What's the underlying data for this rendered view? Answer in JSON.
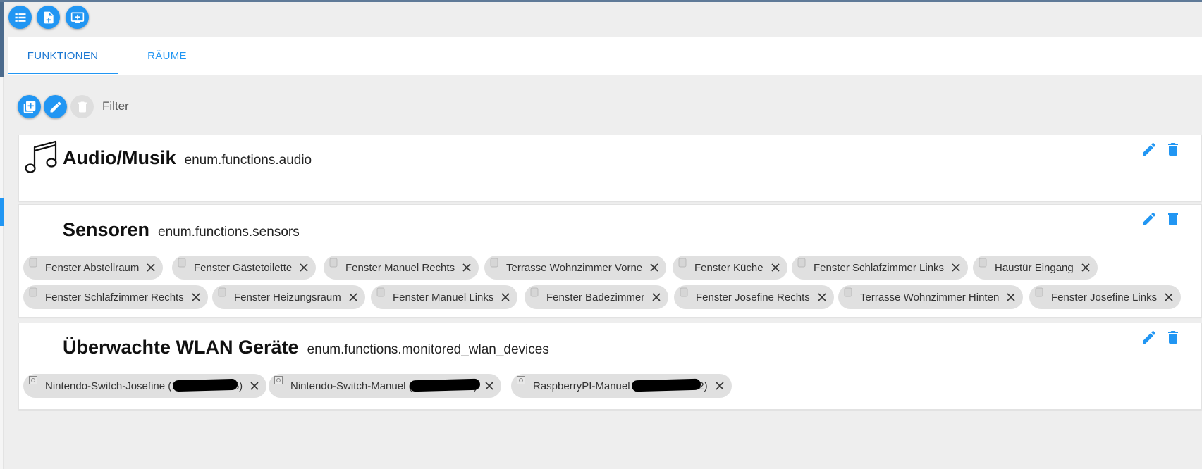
{
  "toolbar_top": {
    "buttons": [
      {
        "name": "list-view-button",
        "icon": "list-icon"
      },
      {
        "name": "add-file-button",
        "icon": "file-plus-icon"
      },
      {
        "name": "add-window-button",
        "icon": "window-plus-icon"
      }
    ]
  },
  "tabs": [
    {
      "label": "FUNKTIONEN",
      "active": true
    },
    {
      "label": "RÄUME",
      "active": false
    }
  ],
  "list_toolbar": {
    "add_icon": "add-library-icon",
    "edit_icon": "pencil-icon",
    "delete_icon": "trash-icon",
    "filter_placeholder": "Filter",
    "filter_value": ""
  },
  "enums": [
    {
      "name": "Audio/Musik",
      "id": "enum.functions.audio",
      "icon": "music-note-icon",
      "members": []
    },
    {
      "name": "Sensoren",
      "id": "enum.functions.sensors",
      "members": [
        "Fenster Abstellraum",
        "Fenster Gästetoilette",
        "Fenster Manuel Rechts",
        "Terrasse Wohnzimmer Vorne",
        "Fenster Küche",
        "Fenster Schlafzimmer Links",
        "Haustür Eingang",
        "Fenster Schlafzimmer Rechts",
        "Fenster Heizungsraum",
        "Fenster Manuel Links",
        "Fenster Badezimmer",
        "Fenster Josefine Rechts",
        "Terrasse Wohnzimmer Hinten",
        "Fenster Josefine Links"
      ]
    },
    {
      "name": "Überwachte WLAN Geräte",
      "id": "enum.functions.monitored_wlan_devices",
      "members": [
        "Nintendo-Switch-Josefine (192.168.15.75)",
        "Nintendo-Switch-Manuel (192.168.15.5)",
        "RaspberryPI-Manuel (192.168.15.72)"
      ]
    }
  ],
  "colors": {
    "accent": "#2196f3",
    "chip_bg": "#e0e0e0",
    "background": "#eeeeee",
    "card_bg": "#ffffff"
  }
}
